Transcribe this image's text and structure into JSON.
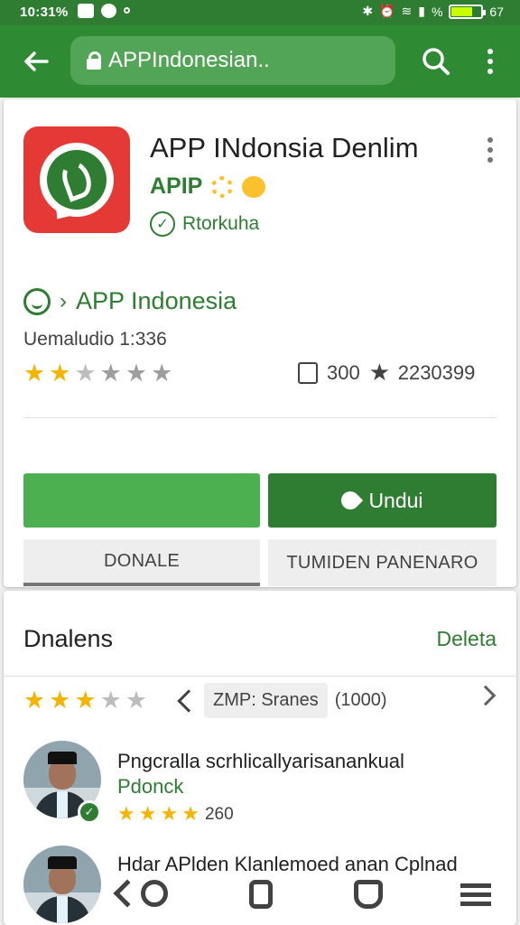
{
  "statusbar": {
    "time": "10:31%",
    "signal_percent": "%",
    "battery_label": "67",
    "battery_level_percent": 67
  },
  "browser": {
    "url": "APPIndonesian..",
    "icons": [
      "back-arrow-icon",
      "lock-icon",
      "search-icon",
      "more-vert-icon"
    ]
  },
  "app": {
    "title": "APP INdonsia Denlim",
    "developer": "APIP",
    "verified_label": "Rtorkuha",
    "package_name": "APP Indonesia",
    "version": "Uemaludio 1:336",
    "rating_stars": 2,
    "rating_max": 5,
    "likes": "300",
    "shares": "2230399",
    "icon_colors": {
      "background": "#e53935",
      "inner": "#2e7d32"
    }
  },
  "actions": {
    "install_label": "Undui",
    "tab_1": "DONALE",
    "tab_2": "TUMIDEN PANENARO"
  },
  "reviews": {
    "title": "Dnalens",
    "link": "Deleta",
    "summary_stars": 3,
    "chip_label": "ZMP: Sranes",
    "chip_count": "(1000)",
    "items": [
      {
        "name": "Pngcralla scrhlicallyarisanankual",
        "subtitle": "Pdonck",
        "stars": 4,
        "count": "260"
      },
      {
        "name": "Hdar APlden Klanlemoed anan Cplnad"
      }
    ]
  },
  "colors": {
    "primary": "#2e7d32",
    "appbar": "#2e8b34",
    "button_light": "#4caf50",
    "star": "#f4b400"
  }
}
